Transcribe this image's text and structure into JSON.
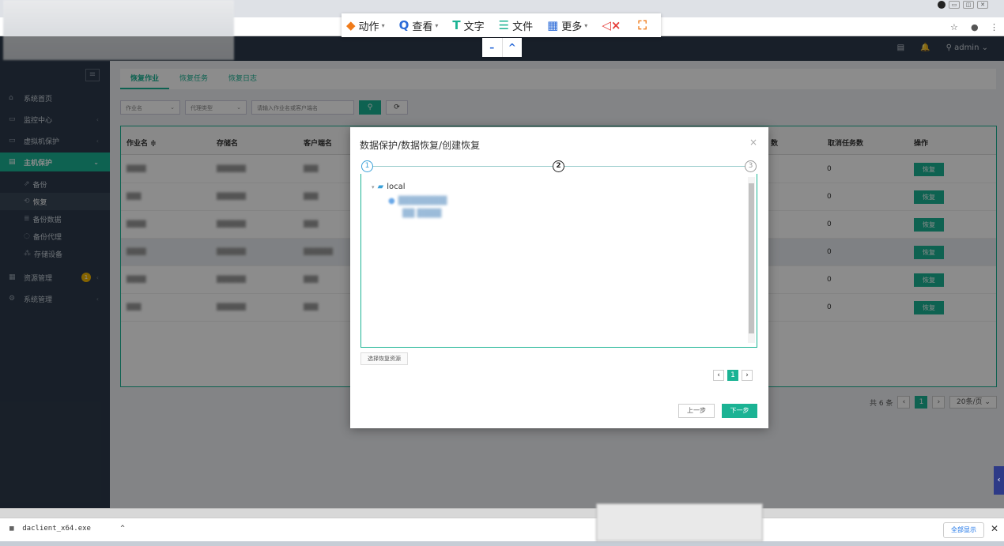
{
  "remote_toolbar": {
    "items": [
      {
        "label": "动作",
        "icon": "layers-icon",
        "caret": "▾"
      },
      {
        "label": "查看",
        "icon": "search-icon",
        "caret": "▾"
      },
      {
        "label": "文字",
        "icon": "text-t-icon"
      },
      {
        "label": "文件",
        "icon": "file-icon"
      },
      {
        "label": "更多",
        "icon": "grid-icon",
        "caret": "▾"
      }
    ],
    "minimize": "–",
    "collapse": "^"
  },
  "header": {
    "user": "admin"
  },
  "sidebar": {
    "items": [
      {
        "label": "系统首页",
        "icon": "home-icon"
      },
      {
        "label": "监控中心",
        "icon": "monitor-icon",
        "chev": "‹"
      },
      {
        "label": "虚拟机保护",
        "icon": "vm-icon",
        "chev": "‹"
      },
      {
        "label": "主机保护",
        "icon": "host-icon",
        "chev": "⌄"
      },
      {
        "label": "资源管理",
        "icon": "resource-icon",
        "chev": "‹",
        "badge": "1"
      },
      {
        "label": "系统管理",
        "icon": "settings-icon",
        "chev": "‹"
      }
    ],
    "subitems": [
      {
        "label": "备份"
      },
      {
        "label": "恢复"
      },
      {
        "label": "备份数据"
      },
      {
        "label": "备份代理"
      },
      {
        "label": "存储设备"
      }
    ]
  },
  "tabs": [
    "恢复作业",
    "恢复任务",
    "恢复日志"
  ],
  "filters": {
    "job_name": "作业名",
    "agent_type": "代理类型",
    "search_placeholder": "请输入作业名或客户端名"
  },
  "table": {
    "headers": [
      "作业名 ≑",
      "存储名",
      "客户端名",
      "数",
      "取消任务数",
      "操作"
    ],
    "row_values": [
      "0",
      "0",
      "0",
      "0",
      "0",
      "0"
    ],
    "action_label": "恢复"
  },
  "pager": {
    "total": "共 6 条",
    "page": "1",
    "per_page": "20条/页"
  },
  "modal": {
    "title": "数据保护/数据恢复/创建恢复",
    "close": "×",
    "steps": [
      "1",
      "2",
      "3"
    ],
    "tree_root": "local",
    "select_button": "选择恢复资源",
    "page": "1",
    "prev": "上一步",
    "next": "下一步"
  },
  "download": {
    "file": "daclient_x64.exe",
    "show_all": "全部显示",
    "close": "✕"
  },
  "colors": {
    "accent": "#1bb394",
    "sidebar": "#2d3a4b"
  }
}
